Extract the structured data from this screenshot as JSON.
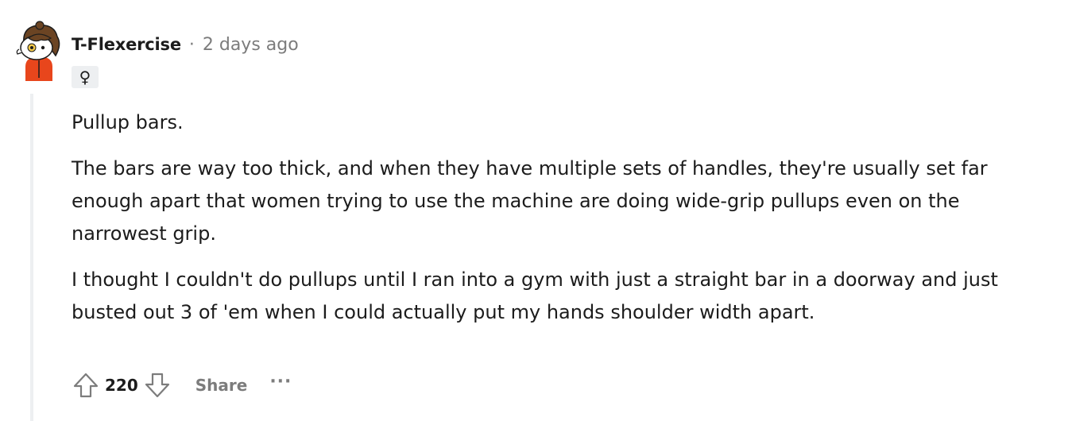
{
  "comment": {
    "author": "T-Flexercise",
    "separator": "·",
    "timestamp": "2 days ago",
    "flair": "♀",
    "paragraphs": [
      "Pullup bars.",
      "The bars are way too thick, and when they have multiple sets of handles, they're usually set far enough apart that women trying to use the machine are doing wide-grip pullups even on the narrowest grip.",
      "I thought I couldn't do pullups until I ran into a gym with just a straight bar in a doorway and just busted out 3 of 'em when I could actually put my hands shoulder width apart."
    ],
    "score": "220",
    "share_label": "Share",
    "more_label": "···"
  },
  "icons": {
    "avatar": "snoo-avatar",
    "upvote": "upvote-arrow-icon",
    "downvote": "downvote-arrow-icon",
    "more": "more-options-icon"
  },
  "colors": {
    "text": "#1c1c1c",
    "muted": "#7c7c7c",
    "thread_line": "#edeff1",
    "flair_bg": "#edeff1",
    "avatar_shirt": "#e8461c",
    "avatar_hair": "#6b4423"
  }
}
